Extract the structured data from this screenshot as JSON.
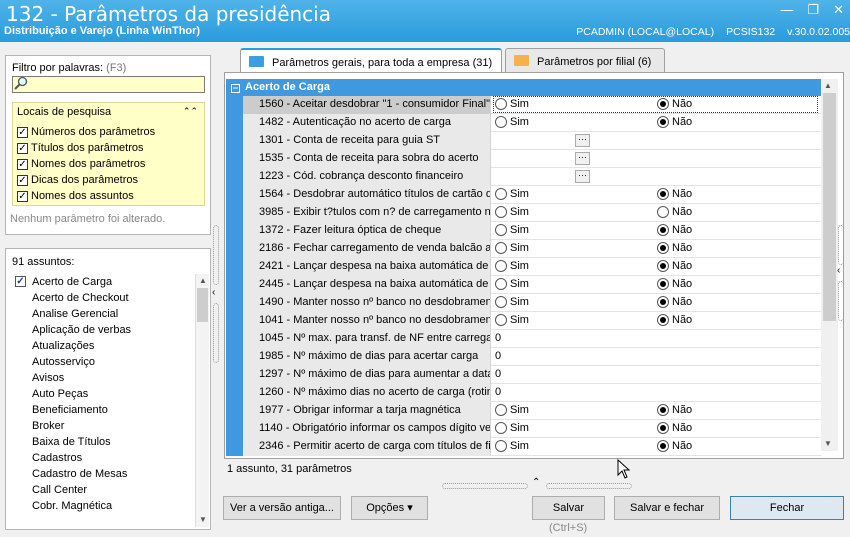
{
  "window": {
    "title": "132 - Parâmetros da presidência",
    "subtitle": "Distribuição e Varejo (Linha WinThor)",
    "user": "PCADMIN (LOCAL@LOCAL)",
    "module": "PCSIS132",
    "version": "v.30.0.02.005",
    "minimize_glyph": "—",
    "restore_glyph": "❐",
    "close_glyph": "✕"
  },
  "filter": {
    "label": "Filtro por palavras:",
    "shortcut": "(F3)",
    "value": "",
    "search_locations_title": "Locais de pesquisa",
    "options": [
      {
        "label": "Números dos parâmetros",
        "checked": true
      },
      {
        "label": "Títulos dos parâmetros",
        "checked": true
      },
      {
        "label": "Nomes dos parâmetros",
        "checked": true
      },
      {
        "label": "Dicas dos parâmetros",
        "checked": true
      },
      {
        "label": "Nomes dos assuntos",
        "checked": true
      }
    ],
    "no_changes_text": "Nenhum parâmetro foi alterado."
  },
  "subjects": {
    "count_label": "91 assuntos:",
    "items": [
      "Acerto de Carga",
      "Acerto de Checkout",
      "Analise Gerencial",
      "Aplicação de verbas",
      "Atualizações",
      "Autosserviço",
      "Avisos",
      "Auto Peças",
      "Beneficiamento",
      "Broker",
      "Baixa de Títulos",
      "Cadastros",
      "Cadastro de Mesas",
      "Call Center",
      "Cobr. Magnética"
    ]
  },
  "tabs": [
    {
      "label": "Parâmetros gerais, para toda a empresa",
      "count": "(31)"
    },
    {
      "label": "Parâmetros por filial",
      "count": "(6)"
    }
  ],
  "grid": {
    "group_label": "Acerto de Carga",
    "yes_label": "Sim",
    "no_label": "Não",
    "ellipsis": "···",
    "rows": [
      {
        "label": "1560 - Aceitar desdobrar \"1 - consumidor Final\"",
        "type": "bool",
        "value": "Não"
      },
      {
        "label": "1482 - Autenticação no acerto de carga",
        "type": "bool",
        "value": "Não"
      },
      {
        "label": "1301 - Conta de receita para guia ST",
        "type": "lookup"
      },
      {
        "label": "1535 - Conta de receita para sobra do acerto",
        "type": "lookup"
      },
      {
        "label": "1223 - Cód. cobrança desconto financeiro",
        "type": "lookup"
      },
      {
        "label": "1564 - Desdobrar automático títulos de cartão d",
        "type": "bool",
        "value": "Não"
      },
      {
        "label": "3985 - Exibir t?tulos com n? de carregamento no",
        "type": "bool",
        "value": "none"
      },
      {
        "label": "1372 - Fazer leitura óptica de cheque",
        "type": "bool",
        "value": "Não"
      },
      {
        "label": "2186 - Fechar carregamento de venda balcão au",
        "type": "bool",
        "value": "Não"
      },
      {
        "label": "2421 - Lançar despesa na baixa automática de t",
        "type": "bool",
        "value": "Não"
      },
      {
        "label": "2445 - Lançar despesa na baixa automática de t",
        "type": "bool",
        "value": "Não"
      },
      {
        "label": "1490 - Manter nosso nº banco no desdobrament",
        "type": "bool",
        "value": "Não"
      },
      {
        "label": "1041 - Manter nosso nº banco no desdobrament",
        "type": "bool",
        "value": "Não"
      },
      {
        "label": "1045 - Nº max. para transf. de NF entre carrega",
        "type": "number",
        "value": "0"
      },
      {
        "label": "1985 - Nº máximo de dias para acertar carga",
        "type": "number",
        "value": "0"
      },
      {
        "label": "1297 - Nº máximo de dias para aumentar a data",
        "type": "number",
        "value": "0"
      },
      {
        "label": "1260 - Nº máximo dias no acerto de carga (rotin",
        "type": "number",
        "value": "0"
      },
      {
        "label": "1977 - Obrigar informar a tarja magnética",
        "type": "bool",
        "value": "Não"
      },
      {
        "label": "1140 - Obrigatório informar os campos dígito ver",
        "type": "bool",
        "value": "Não"
      },
      {
        "label": "2346 - Permitir acerto de carga com títulos de fil",
        "type": "bool",
        "value": "Não"
      }
    ],
    "status": "1 assunto, 31 parâmetros"
  },
  "buttons": {
    "old_version": "Ver a versão antiga...",
    "options": "Opções",
    "save": "Salvar",
    "save_shortcut": "(Ctrl+S)",
    "save_close": "Salvar e fechar",
    "close": "Fechar"
  },
  "colors": {
    "accent": "#2a9bdc",
    "group": "#3f99e0",
    "highlight": "#ffffc8"
  }
}
